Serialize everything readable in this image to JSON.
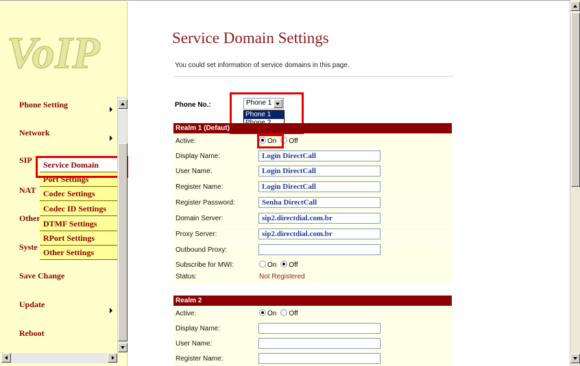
{
  "logo_text": "VoIP",
  "nav": {
    "phone_setting": "Phone Setting",
    "network": "Network",
    "sip_partial": "SIP",
    "nat_partial": "NAT",
    "other_partial": "Other",
    "system_partial": "Syste",
    "save_change": "Save Change",
    "update": "Update",
    "reboot": "Reboot"
  },
  "submenu": [
    {
      "label": "Service Domain"
    },
    {
      "label": "Port Settings"
    },
    {
      "label": "Codec Settings"
    },
    {
      "label": "Codec ID Settings"
    },
    {
      "label": "DTMF Settings"
    },
    {
      "label": "RPort Settings"
    },
    {
      "label": "Other Settings"
    }
  ],
  "page": {
    "title": "Service Domain Settings",
    "description": "You could set information of service domains in this page."
  },
  "phone": {
    "label": "Phone No.:",
    "selected": "Phone 1",
    "options": [
      "Phone 1",
      "Phone 2"
    ]
  },
  "realm1": {
    "header": "Realm 1 (Defau",
    "header_tail": "t)",
    "active_label": "Active:",
    "on": "On",
    "off": "Off",
    "display_name_label": "Display Name:",
    "display_name": "Login DirectCall",
    "user_name_label": "User Name:",
    "user_name": "Login DirectCall",
    "register_name_label": "Register Name:",
    "register_name": "Login DirectCall",
    "register_password_label": "Register Password:",
    "register_password": "Senha DirectCall",
    "domain_server_label": "Domain Server:",
    "domain_server": "sip2.directdial.com.br",
    "proxy_server_label": "Proxy Server:",
    "proxy_server": "sip2.directdial.com.br",
    "outbound_proxy_label": "Outbound Proxy:",
    "outbound_proxy": "",
    "mwi_label": "Subscribe for MWI:",
    "mwi_on": "On",
    "mwi_off": "Off",
    "status_label": "Status:",
    "status": "Not Registered"
  },
  "realm2": {
    "header": "Realm 2",
    "active_label": "Active:",
    "on": "On",
    "off": "Off",
    "display_name_label": "Display Name:",
    "user_name_label": "User Name:",
    "register_name_label": "Register Name:"
  },
  "colors": {
    "accent": "#8b0000",
    "highlight": "#e00000",
    "sidebar_bg": "#ffffcc"
  }
}
